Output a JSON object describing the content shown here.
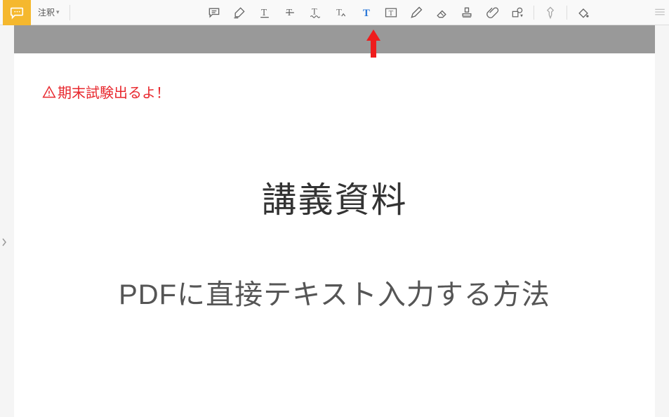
{
  "toolbar": {
    "dropdown_label": "注釈"
  },
  "document": {
    "annotation_text": "期末試験出るよ！",
    "title": "講義資料",
    "subtitle": "PDFに直接テキスト入力する方法"
  },
  "icons": {
    "comment": "comment-bubble",
    "tools": [
      "note-icon",
      "highlight-icon",
      "text-highlight-icon",
      "strikethrough-icon",
      "squiggly-icon",
      "text-replace-icon",
      "typewriter-icon",
      "textbox-icon",
      "pencil-icon",
      "eraser-icon",
      "stamp-icon",
      "attach-icon",
      "shapes-icon"
    ]
  }
}
